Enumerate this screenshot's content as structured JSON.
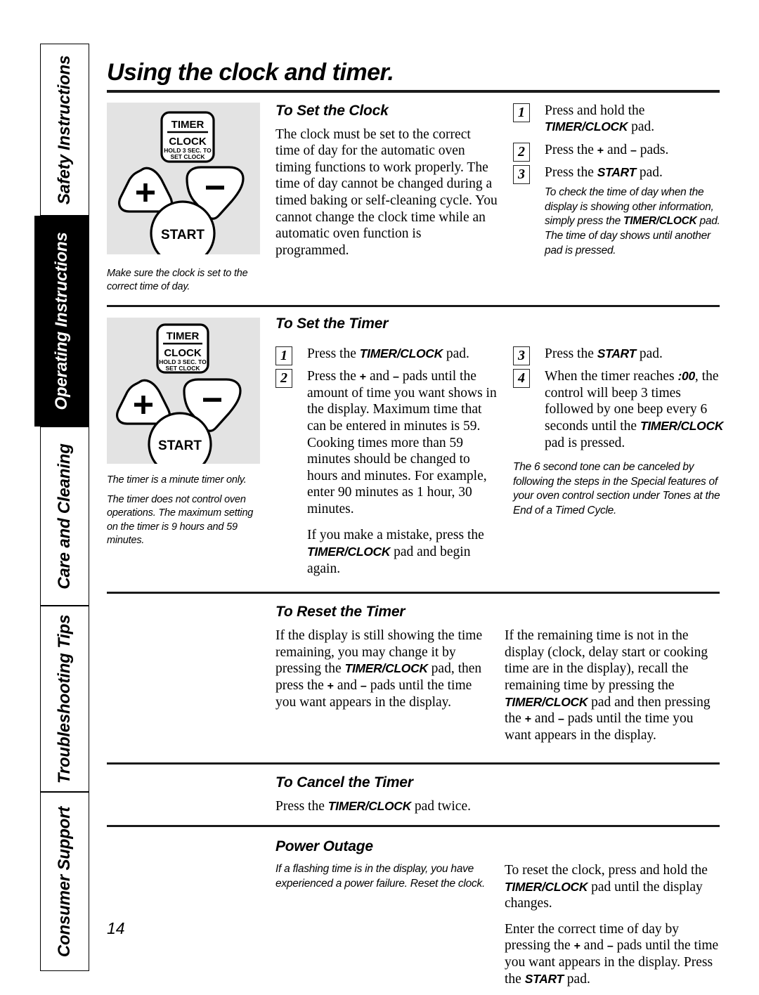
{
  "page": {
    "title": "Using the clock and timer.",
    "number": "14"
  },
  "sidebar": {
    "tabs": [
      {
        "label": "Safety Instructions",
        "active": false
      },
      {
        "label": "Operating Instructions",
        "active": true
      },
      {
        "label": "Care and Cleaning",
        "active": false
      },
      {
        "label": "Troubleshooting Tips",
        "active": false
      },
      {
        "label": "Consumer Support",
        "active": false
      }
    ]
  },
  "control_panel": {
    "timer_clock_line1": "TIMER",
    "timer_clock_line2": "CLOCK",
    "timer_clock_line3": "HOLD 3 SEC. TO",
    "timer_clock_line4": "SET CLOCK",
    "plus_label": "+",
    "minus_label": "–",
    "start_label": "START"
  },
  "sections": {
    "set_clock": {
      "heading": "To Set the Clock",
      "body": "The clock must be set to the correct time of day for the automatic oven timing functions to work properly. The time of day cannot be changed during a timed baking or self-cleaning cycle. You cannot change the clock time while an automatic oven function is programmed.",
      "caption": "Make sure the clock is set to the correct time of day.",
      "steps": [
        {
          "num": "1",
          "prefix": "Press and hold the ",
          "pad": "TIMER/CLOCK",
          "suffix": " pad."
        },
        {
          "num": "2",
          "prefix": "Press the ",
          "pad": "",
          "suffix": ""
        },
        {
          "num": "3",
          "prefix": "Press the ",
          "pad": "START",
          "suffix": " pad."
        }
      ],
      "step2_text_a": "Press the ",
      "step2_text_b": " and ",
      "step2_text_c": " pads.",
      "note": "To check the time of day when the display is showing other information, simply press the TIMER/CLOCK pad. The time of day shows until another pad is pressed.",
      "note_a": "To check the time of day when the display is showing other information, simply press the ",
      "note_pad": "TIMER/CLOCK",
      "note_b": " pad. The time of day shows until another pad is pressed."
    },
    "set_timer": {
      "heading": "To Set the Timer",
      "caption1": "The timer is a minute timer only.",
      "caption2": "The timer does not control oven operations. The maximum setting on the timer is 9 hours and 59 minutes.",
      "step1_a": "Press the ",
      "step1_pad": "TIMER/CLOCK",
      "step1_b": " pad.",
      "step2_a": "Press the ",
      "step2_b": " and ",
      "step2_c": " pads until the amount of time you want shows in the display. Maximum time that can be entered in minutes is 59. Cooking times more than 59 minutes should be changed to hours and minutes. For example, enter 90 minutes as 1 hour, 30 minutes.",
      "mistake_a": "If you make a mistake, press the ",
      "mistake_pad": "TIMER/CLOCK",
      "mistake_b": " pad and begin again.",
      "step3_a": "Press the ",
      "step3_pad": "START",
      "step3_b": " pad.",
      "step4_a": "When the timer reaches ",
      "step4_display": ":00",
      "step4_b": ", the control will beep 3 times followed by one beep every 6 seconds until the ",
      "step4_pad": "TIMER/CLOCK",
      "step4_c": " pad is pressed.",
      "note": "The 6 second tone can be canceled by following the steps in the Special features of your oven control section under Tones at the End of a Timed Cycle."
    },
    "reset_timer": {
      "heading": "To Reset the Timer",
      "left_a": "If the display is still showing the time remaining, you may change it by pressing the ",
      "left_pad": "TIMER/CLOCK",
      "left_b": " pad, then press the ",
      "left_c": " and ",
      "left_d": " pads until the time you want appears in the display.",
      "right_a": "If the remaining time is not in the display (clock, delay start or cooking time are in the display), recall the remaining time by pressing the ",
      "right_pad": "TIMER/CLOCK",
      "right_b": " pad and then pressing the ",
      "right_c": " and ",
      "right_d": " pads until the time you want appears in the display."
    },
    "cancel_timer": {
      "heading": "To Cancel the Timer",
      "body_a": "Press the ",
      "body_pad": "TIMER/CLOCK",
      "body_b": " pad twice."
    },
    "power_outage": {
      "heading": "Power Outage",
      "left_note": "If a flashing time is in the display, you have experienced a power failure. Reset the clock.",
      "right_p1_a": "To reset the clock, press and hold the ",
      "right_p1_pad": "TIMER/CLOCK",
      "right_p1_b": " pad until the display changes.",
      "right_p2_a": "Enter the correct time of day by pressing the ",
      "right_p2_b": " and ",
      "right_p2_c": " pads until the time you want appears in the display. Press the ",
      "right_p2_pad": "START",
      "right_p2_d": " pad."
    }
  },
  "colors": {
    "panel_bg": "#e3e3e3",
    "rule": "#1a1a1a",
    "active_tab_bg": "#000000"
  }
}
